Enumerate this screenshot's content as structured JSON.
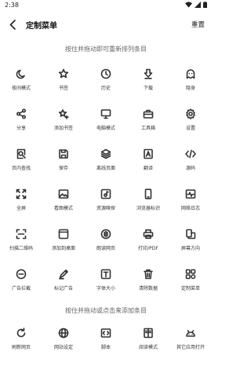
{
  "status": {
    "time": "2:38"
  },
  "header": {
    "title": "定制菜单",
    "reset_label": "重置"
  },
  "hints": {
    "current": "按住并拖动即可重新排列条目",
    "available": "按住并拖动或点击来添加条目"
  },
  "menu_items": [
    {
      "label": "夜间模式",
      "icon": "moon-icon"
    },
    {
      "label": "书签",
      "icon": "star-icon"
    },
    {
      "label": "历史",
      "icon": "clock-icon"
    },
    {
      "label": "下载",
      "icon": "download-icon"
    },
    {
      "label": "隐身",
      "icon": "ghost-icon"
    },
    {
      "label": "分享",
      "icon": "share-icon"
    },
    {
      "label": "添加书签",
      "icon": "star-plus-icon"
    },
    {
      "label": "电脑模式",
      "icon": "monitor-icon"
    },
    {
      "label": "工具箱",
      "icon": "toolbox-icon"
    },
    {
      "label": "设置",
      "icon": "gear-icon"
    },
    {
      "label": "页内查找",
      "icon": "find-in-page-icon"
    },
    {
      "label": "保存",
      "icon": "save-icon"
    },
    {
      "label": "离线页面",
      "icon": "layers-icon"
    },
    {
      "label": "翻译",
      "icon": "translate-icon"
    },
    {
      "label": "源码",
      "icon": "code-icon"
    },
    {
      "label": "全屏",
      "icon": "fullscreen-icon"
    },
    {
      "label": "看图模式",
      "icon": "image-icon"
    },
    {
      "label": "资源嗅探",
      "icon": "media-icon"
    },
    {
      "label": "浏览器标识",
      "icon": "phone-icon"
    },
    {
      "label": "网络日志",
      "icon": "network-log-icon"
    },
    {
      "label": "扫描二维码",
      "icon": "scan-icon"
    },
    {
      "label": "添加到桌面",
      "icon": "add-to-desktop-icon"
    },
    {
      "label": "朗读网页",
      "icon": "read-aloud-icon"
    },
    {
      "label": "打印/PDF",
      "icon": "printer-icon"
    },
    {
      "label": "屏幕方向",
      "icon": "rotate-screen-icon"
    },
    {
      "label": "广告拦截",
      "icon": "block-icon"
    },
    {
      "label": "标记广告",
      "icon": "mark-ad-icon"
    },
    {
      "label": "字体大小",
      "icon": "font-size-icon"
    },
    {
      "label": "清除数据",
      "icon": "trash-icon"
    },
    {
      "label": "定制菜单",
      "icon": "customize-menu-icon"
    }
  ],
  "available_items": [
    {
      "label": "刷新网页",
      "icon": "refresh-icon"
    },
    {
      "label": "网站设定",
      "icon": "globe-icon"
    },
    {
      "label": "脚本",
      "icon": "script-icon"
    },
    {
      "label": "阅读模式",
      "icon": "reader-mode-icon"
    },
    {
      "label": "其它应用打开",
      "icon": "android-icon"
    }
  ]
}
